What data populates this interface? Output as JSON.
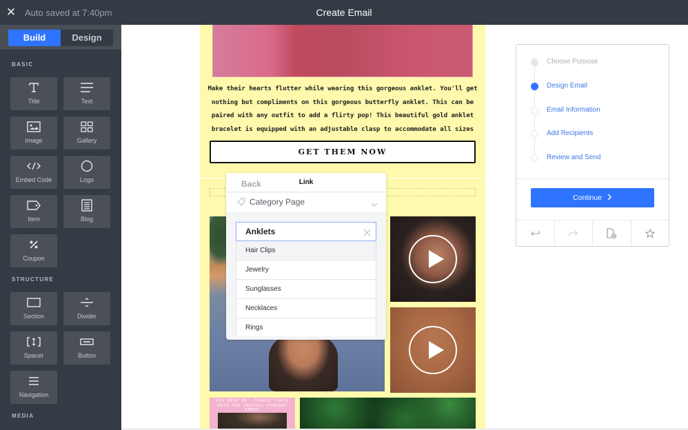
{
  "header": {
    "close_icon": "close-icon",
    "autosave": "Auto saved at 7:40pm",
    "title": "Create Email"
  },
  "sidebar": {
    "tabs": [
      {
        "label": "Build",
        "active": true
      },
      {
        "label": "Design",
        "active": false
      }
    ],
    "sections": [
      {
        "label": "BASIC",
        "items": [
          {
            "label": "Title",
            "icon": "title-icon"
          },
          {
            "label": "Text",
            "icon": "text-lines-icon"
          },
          {
            "label": "Image",
            "icon": "image-icon"
          },
          {
            "label": "Gallery",
            "icon": "gallery-grid-icon"
          },
          {
            "label": "Embed Code",
            "icon": "code-icon"
          },
          {
            "label": "Logo",
            "icon": "circle-icon"
          },
          {
            "label": "Item",
            "icon": "tag-icon"
          },
          {
            "label": "Blog",
            "icon": "blog-icon"
          },
          {
            "label": "Coupon",
            "icon": "percent-icon"
          }
        ]
      },
      {
        "label": "STRUCTURE",
        "items": [
          {
            "label": "Section",
            "icon": "section-icon"
          },
          {
            "label": "Divider",
            "icon": "divider-icon"
          },
          {
            "label": "Spacer",
            "icon": "spacer-icon"
          },
          {
            "label": "Button",
            "icon": "button-icon"
          },
          {
            "label": "Navigation",
            "icon": "menu-icon"
          }
        ]
      },
      {
        "label": "MEDIA",
        "items": []
      }
    ]
  },
  "email": {
    "description": "Make their hearts flutter while wearing this gorgeous anklet. You'll get nothing but compliments on this gorgeous butterfly anklet. This can be paired with any outfit to add a flirty pop! This beautiful gold anklet bracelet is equipped with an adjustable clasp to accommodate all sizes",
    "cta_label": "GET THEM NOW",
    "promo_text": "OUR'DROP ME' TENNIS CHAIN WITH THE INITIAL PENDANT ADDED",
    "colors": {
      "background": "#fef9ac",
      "promo": "#f3b3cf"
    }
  },
  "link_popover": {
    "back_label": "Back",
    "title": "Link",
    "link_type": "Category Page",
    "search_value": "Anklets",
    "options": [
      "Hair Clips",
      "Jewelry",
      "Sunglasses",
      "Necklaces",
      "Rings"
    ],
    "highlighted_option": "Hair Clips"
  },
  "steps_panel": {
    "steps": [
      {
        "label": "Choose Purpose",
        "state": "done"
      },
      {
        "label": "Design Email",
        "state": "current"
      },
      {
        "label": "Email Information",
        "state": "todo"
      },
      {
        "label": "Add Recipients",
        "state": "todo"
      },
      {
        "label": "Review and Send",
        "state": "todo"
      }
    ],
    "continue_label": "Continue",
    "tools": [
      "undo-icon",
      "redo-icon",
      "discard-draft-icon",
      "favorite-star-icon"
    ],
    "accent": "#2f74ff"
  }
}
